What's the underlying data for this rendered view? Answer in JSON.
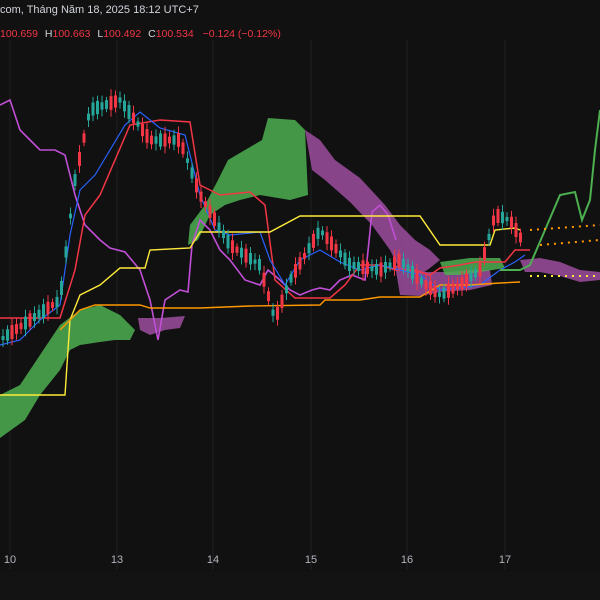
{
  "header": {
    "datetime": "com, Tháng Năm 18, 2025 18:12 UTC+7"
  },
  "ohlc": {
    "open_value": "100.659",
    "high_label": "H",
    "high_value": "100.663",
    "low_label": "L",
    "low_value": "100.492",
    "close_label": "C",
    "close_value": "100.534",
    "change": "−0.124 (−0.12%)",
    "value_color": "#f23645"
  },
  "colors": {
    "background": "#111111",
    "up_candle": "#26a69a",
    "down_candle": "#f23645",
    "tenkan": "#2962ff",
    "kijun": "#f23645",
    "chikou": "#c04fd6",
    "senkou_a": "#ffeb3b",
    "senkou_b": "#ff9800",
    "kumo_bull": "#4caf50",
    "kumo_bear": "#9c4d9e",
    "future_line": "#4caf50",
    "grid": "#1f1f1f"
  },
  "chart_data": {
    "type": "line",
    "x_axis": {
      "ticks": [
        "10",
        "13",
        "14",
        "15",
        "16",
        "17"
      ]
    },
    "series": []
  }
}
